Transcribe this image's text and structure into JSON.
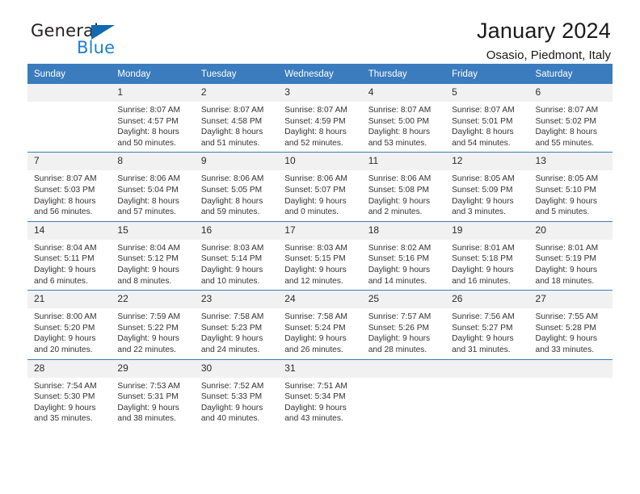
{
  "brand": {
    "name_dark": "General",
    "name_light": "Blue",
    "accent_color": "#1d7fd0",
    "triangle_color": "#1369b0"
  },
  "header": {
    "title": "January 2024",
    "subtitle": "Osasio, Piedmont, Italy"
  },
  "calendar": {
    "header_bg": "#3a7cbe",
    "daynum_bg": "#f1f1f1",
    "weekdays": [
      "Sunday",
      "Monday",
      "Tuesday",
      "Wednesday",
      "Thursday",
      "Friday",
      "Saturday"
    ],
    "weeks": [
      [
        {
          "day": "",
          "blank": true,
          "sunrise": "",
          "sunset": "",
          "daylight1": "",
          "daylight2": ""
        },
        {
          "day": "1",
          "sunrise": "Sunrise: 8:07 AM",
          "sunset": "Sunset: 4:57 PM",
          "daylight1": "Daylight: 8 hours",
          "daylight2": "and 50 minutes."
        },
        {
          "day": "2",
          "sunrise": "Sunrise: 8:07 AM",
          "sunset": "Sunset: 4:58 PM",
          "daylight1": "Daylight: 8 hours",
          "daylight2": "and 51 minutes."
        },
        {
          "day": "3",
          "sunrise": "Sunrise: 8:07 AM",
          "sunset": "Sunset: 4:59 PM",
          "daylight1": "Daylight: 8 hours",
          "daylight2": "and 52 minutes."
        },
        {
          "day": "4",
          "sunrise": "Sunrise: 8:07 AM",
          "sunset": "Sunset: 5:00 PM",
          "daylight1": "Daylight: 8 hours",
          "daylight2": "and 53 minutes."
        },
        {
          "day": "5",
          "sunrise": "Sunrise: 8:07 AM",
          "sunset": "Sunset: 5:01 PM",
          "daylight1": "Daylight: 8 hours",
          "daylight2": "and 54 minutes."
        },
        {
          "day": "6",
          "sunrise": "Sunrise: 8:07 AM",
          "sunset": "Sunset: 5:02 PM",
          "daylight1": "Daylight: 8 hours",
          "daylight2": "and 55 minutes."
        }
      ],
      [
        {
          "day": "7",
          "sunrise": "Sunrise: 8:07 AM",
          "sunset": "Sunset: 5:03 PM",
          "daylight1": "Daylight: 8 hours",
          "daylight2": "and 56 minutes."
        },
        {
          "day": "8",
          "sunrise": "Sunrise: 8:06 AM",
          "sunset": "Sunset: 5:04 PM",
          "daylight1": "Daylight: 8 hours",
          "daylight2": "and 57 minutes."
        },
        {
          "day": "9",
          "sunrise": "Sunrise: 8:06 AM",
          "sunset": "Sunset: 5:05 PM",
          "daylight1": "Daylight: 8 hours",
          "daylight2": "and 59 minutes."
        },
        {
          "day": "10",
          "sunrise": "Sunrise: 8:06 AM",
          "sunset": "Sunset: 5:07 PM",
          "daylight1": "Daylight: 9 hours",
          "daylight2": "and 0 minutes."
        },
        {
          "day": "11",
          "sunrise": "Sunrise: 8:06 AM",
          "sunset": "Sunset: 5:08 PM",
          "daylight1": "Daylight: 9 hours",
          "daylight2": "and 2 minutes."
        },
        {
          "day": "12",
          "sunrise": "Sunrise: 8:05 AM",
          "sunset": "Sunset: 5:09 PM",
          "daylight1": "Daylight: 9 hours",
          "daylight2": "and 3 minutes."
        },
        {
          "day": "13",
          "sunrise": "Sunrise: 8:05 AM",
          "sunset": "Sunset: 5:10 PM",
          "daylight1": "Daylight: 9 hours",
          "daylight2": "and 5 minutes."
        }
      ],
      [
        {
          "day": "14",
          "sunrise": "Sunrise: 8:04 AM",
          "sunset": "Sunset: 5:11 PM",
          "daylight1": "Daylight: 9 hours",
          "daylight2": "and 6 minutes."
        },
        {
          "day": "15",
          "sunrise": "Sunrise: 8:04 AM",
          "sunset": "Sunset: 5:12 PM",
          "daylight1": "Daylight: 9 hours",
          "daylight2": "and 8 minutes."
        },
        {
          "day": "16",
          "sunrise": "Sunrise: 8:03 AM",
          "sunset": "Sunset: 5:14 PM",
          "daylight1": "Daylight: 9 hours",
          "daylight2": "and 10 minutes."
        },
        {
          "day": "17",
          "sunrise": "Sunrise: 8:03 AM",
          "sunset": "Sunset: 5:15 PM",
          "daylight1": "Daylight: 9 hours",
          "daylight2": "and 12 minutes."
        },
        {
          "day": "18",
          "sunrise": "Sunrise: 8:02 AM",
          "sunset": "Sunset: 5:16 PM",
          "daylight1": "Daylight: 9 hours",
          "daylight2": "and 14 minutes."
        },
        {
          "day": "19",
          "sunrise": "Sunrise: 8:01 AM",
          "sunset": "Sunset: 5:18 PM",
          "daylight1": "Daylight: 9 hours",
          "daylight2": "and 16 minutes."
        },
        {
          "day": "20",
          "sunrise": "Sunrise: 8:01 AM",
          "sunset": "Sunset: 5:19 PM",
          "daylight1": "Daylight: 9 hours",
          "daylight2": "and 18 minutes."
        }
      ],
      [
        {
          "day": "21",
          "sunrise": "Sunrise: 8:00 AM",
          "sunset": "Sunset: 5:20 PM",
          "daylight1": "Daylight: 9 hours",
          "daylight2": "and 20 minutes."
        },
        {
          "day": "22",
          "sunrise": "Sunrise: 7:59 AM",
          "sunset": "Sunset: 5:22 PM",
          "daylight1": "Daylight: 9 hours",
          "daylight2": "and 22 minutes."
        },
        {
          "day": "23",
          "sunrise": "Sunrise: 7:58 AM",
          "sunset": "Sunset: 5:23 PM",
          "daylight1": "Daylight: 9 hours",
          "daylight2": "and 24 minutes."
        },
        {
          "day": "24",
          "sunrise": "Sunrise: 7:58 AM",
          "sunset": "Sunset: 5:24 PM",
          "daylight1": "Daylight: 9 hours",
          "daylight2": "and 26 minutes."
        },
        {
          "day": "25",
          "sunrise": "Sunrise: 7:57 AM",
          "sunset": "Sunset: 5:26 PM",
          "daylight1": "Daylight: 9 hours",
          "daylight2": "and 28 minutes."
        },
        {
          "day": "26",
          "sunrise": "Sunrise: 7:56 AM",
          "sunset": "Sunset: 5:27 PM",
          "daylight1": "Daylight: 9 hours",
          "daylight2": "and 31 minutes."
        },
        {
          "day": "27",
          "sunrise": "Sunrise: 7:55 AM",
          "sunset": "Sunset: 5:28 PM",
          "daylight1": "Daylight: 9 hours",
          "daylight2": "and 33 minutes."
        }
      ],
      [
        {
          "day": "28",
          "sunrise": "Sunrise: 7:54 AM",
          "sunset": "Sunset: 5:30 PM",
          "daylight1": "Daylight: 9 hours",
          "daylight2": "and 35 minutes."
        },
        {
          "day": "29",
          "sunrise": "Sunrise: 7:53 AM",
          "sunset": "Sunset: 5:31 PM",
          "daylight1": "Daylight: 9 hours",
          "daylight2": "and 38 minutes."
        },
        {
          "day": "30",
          "sunrise": "Sunrise: 7:52 AM",
          "sunset": "Sunset: 5:33 PM",
          "daylight1": "Daylight: 9 hours",
          "daylight2": "and 40 minutes."
        },
        {
          "day": "31",
          "sunrise": "Sunrise: 7:51 AM",
          "sunset": "Sunset: 5:34 PM",
          "daylight1": "Daylight: 9 hours",
          "daylight2": "and 43 minutes."
        },
        {
          "day": "",
          "blank": true,
          "sunrise": "",
          "sunset": "",
          "daylight1": "",
          "daylight2": ""
        },
        {
          "day": "",
          "blank": true,
          "sunrise": "",
          "sunset": "",
          "daylight1": "",
          "daylight2": ""
        },
        {
          "day": "",
          "blank": true,
          "sunrise": "",
          "sunset": "",
          "daylight1": "",
          "daylight2": ""
        }
      ]
    ]
  }
}
